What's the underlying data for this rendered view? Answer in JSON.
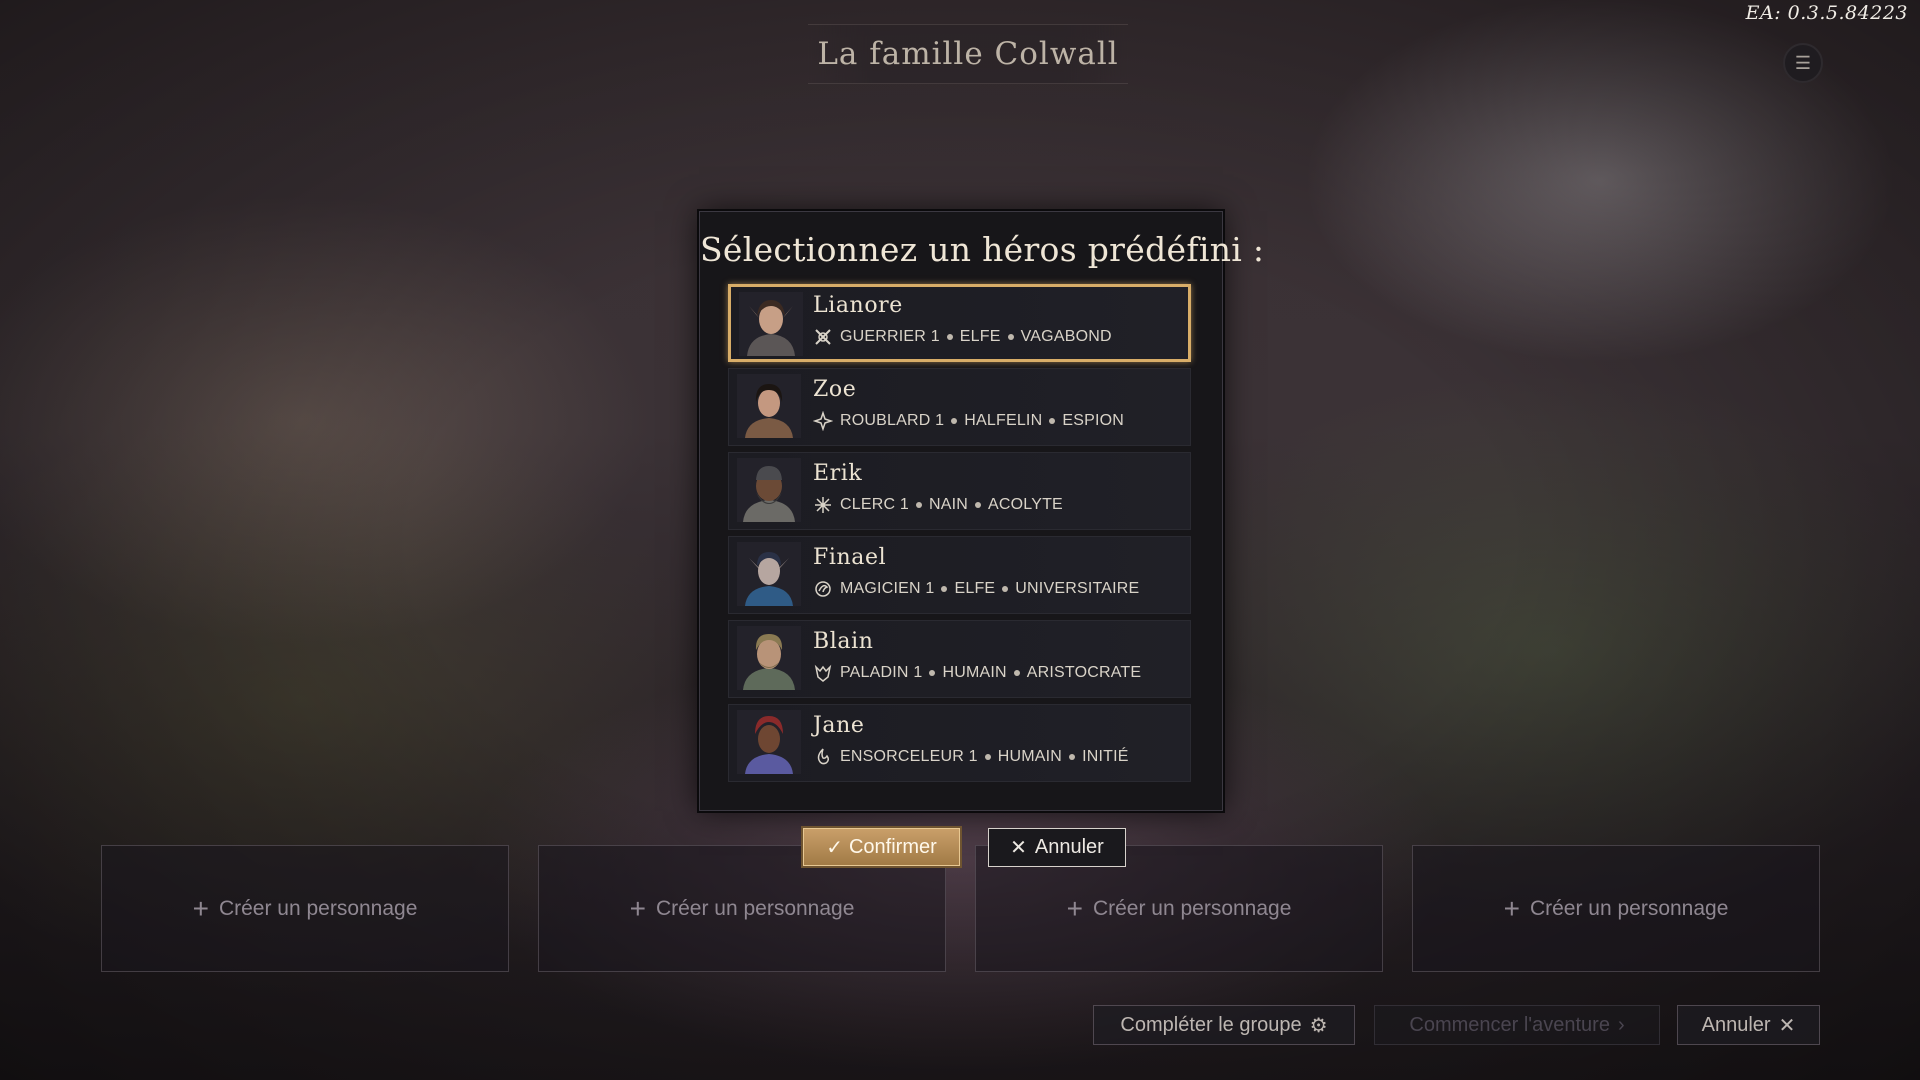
{
  "version": "EA: 0.3.5.84223",
  "party_title": "La famille Colwall",
  "menu_icon": "hamburger-menu-icon",
  "dialog": {
    "title": "Sélectionnez un héros prédéfini :",
    "heroes": [
      {
        "name": "Lianore",
        "class": "GUERRIER 1",
        "race": "ELFE",
        "background": "VAGABOND",
        "icon": "fighter-class-icon",
        "selected": true
      },
      {
        "name": "Zoe",
        "class": "ROUBLARD 1",
        "race": "HALFELIN",
        "background": "ESPION",
        "icon": "rogue-class-icon",
        "selected": false
      },
      {
        "name": "Erik",
        "class": "CLERC 1",
        "race": "NAIN",
        "background": "ACOLYTE",
        "icon": "cleric-class-icon",
        "selected": false
      },
      {
        "name": "Finael",
        "class": "MAGICIEN 1",
        "race": "ELFE",
        "background": "UNIVERSITAIRE",
        "icon": "wizard-class-icon",
        "selected": false
      },
      {
        "name": "Blain",
        "class": "PALADIN 1",
        "race": "HUMAIN",
        "background": "ARISTOCRATE",
        "icon": "paladin-class-icon",
        "selected": false
      },
      {
        "name": "Jane",
        "class": "ENSORCELEUR 1",
        "race": "HUMAIN",
        "background": "INITIÉ",
        "icon": "sorcerer-class-icon",
        "selected": false
      }
    ],
    "confirm_label": "Confirmer",
    "cancel_label": "Annuler"
  },
  "slots": [
    {
      "label": "Créer un personnage"
    },
    {
      "label": "Créer un personnage"
    },
    {
      "label": "Créer un personnage"
    },
    {
      "label": "Créer un personnage"
    }
  ],
  "footer": {
    "complete_party": "Compléter le groupe",
    "start_adventure": "Commencer l'aventure",
    "cancel": "Annuler"
  },
  "colors": {
    "accent_gold": "#d8ad68",
    "dialog_bg": "#171619"
  }
}
